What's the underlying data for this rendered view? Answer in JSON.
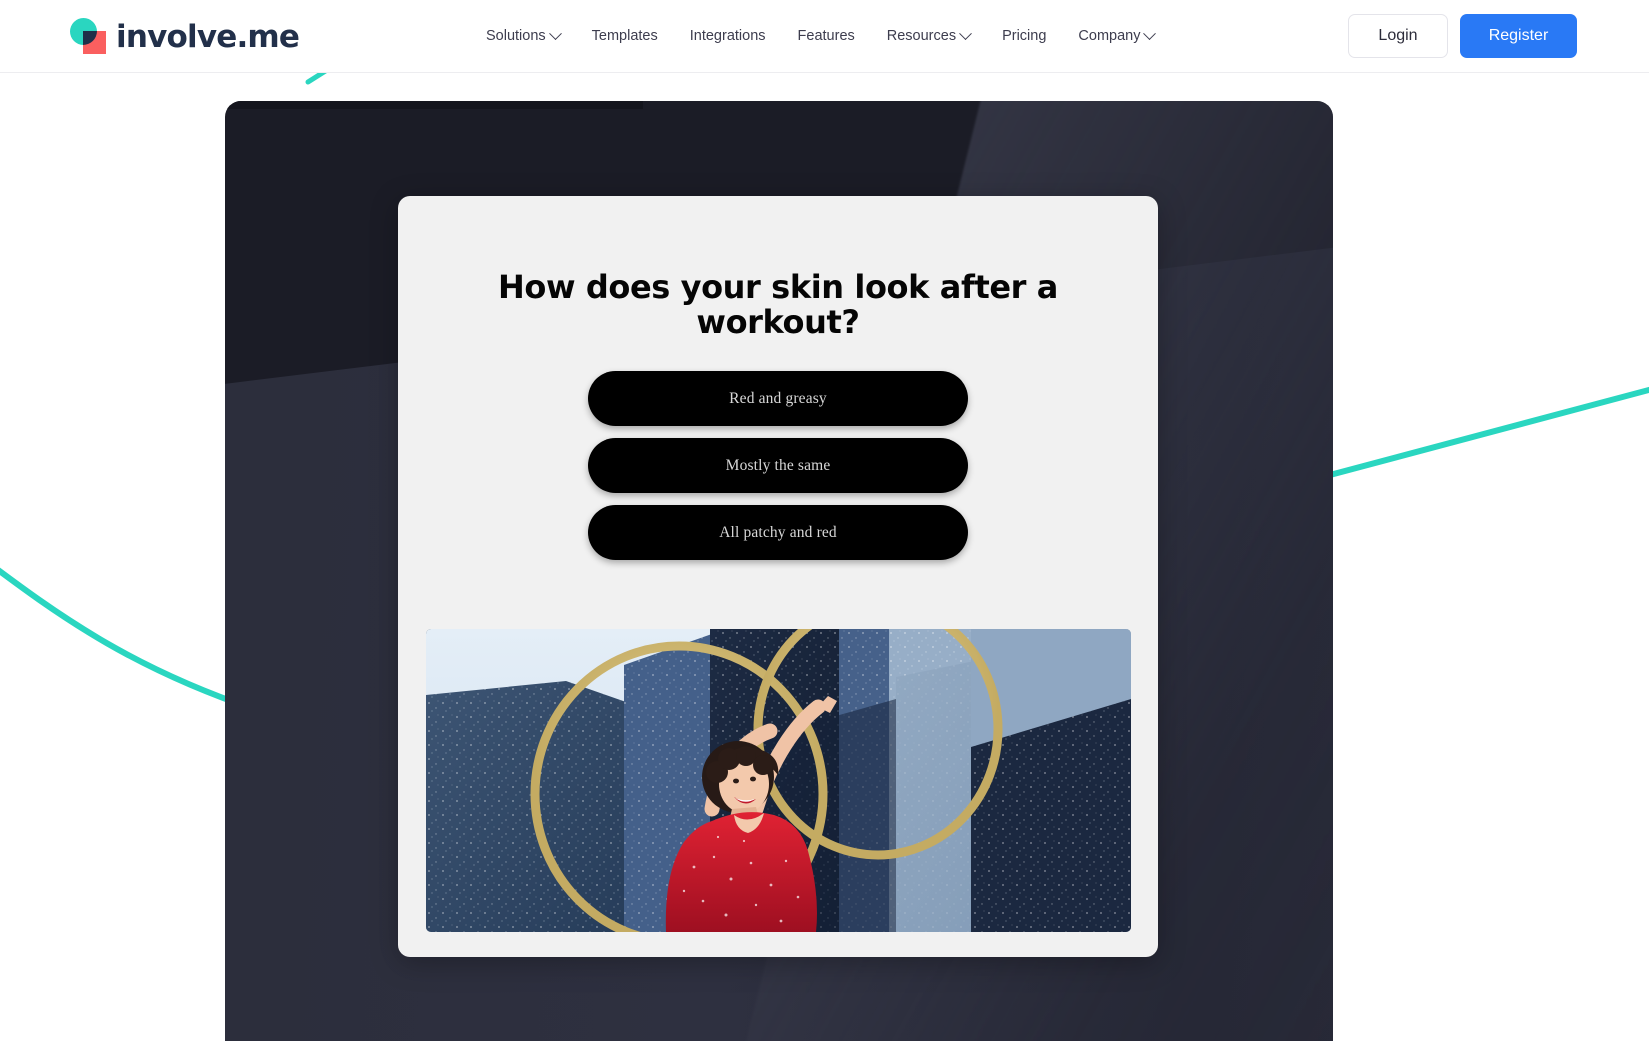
{
  "brand": {
    "logo_text": "involve.me",
    "logo_icon": "involveme-logo-icon",
    "colors": {
      "teal": "#2ad6c0",
      "coral": "#fa5f5f",
      "navy": "#1f3049",
      "accent_blue": "#2979f5"
    }
  },
  "header": {
    "nav": [
      {
        "label": "Solutions",
        "has_dropdown": true
      },
      {
        "label": "Templates",
        "has_dropdown": false
      },
      {
        "label": "Integrations",
        "has_dropdown": false
      },
      {
        "label": "Features",
        "has_dropdown": false
      },
      {
        "label": "Resources",
        "has_dropdown": true
      },
      {
        "label": "Pricing",
        "has_dropdown": false
      },
      {
        "label": "Company",
        "has_dropdown": true
      }
    ],
    "login_label": "Login",
    "register_label": "Register"
  },
  "quiz": {
    "title": "How does your skin look after a workout?",
    "answers": [
      {
        "label": "Red and greasy"
      },
      {
        "label": "Mostly the same"
      },
      {
        "label": "All patchy and red"
      }
    ],
    "image_alt": "Woman in a red sequin dress holding golden hula hoops in front of dark blue granite buildings",
    "card_background": "#f1f1f1",
    "answer_background": "#000000"
  }
}
